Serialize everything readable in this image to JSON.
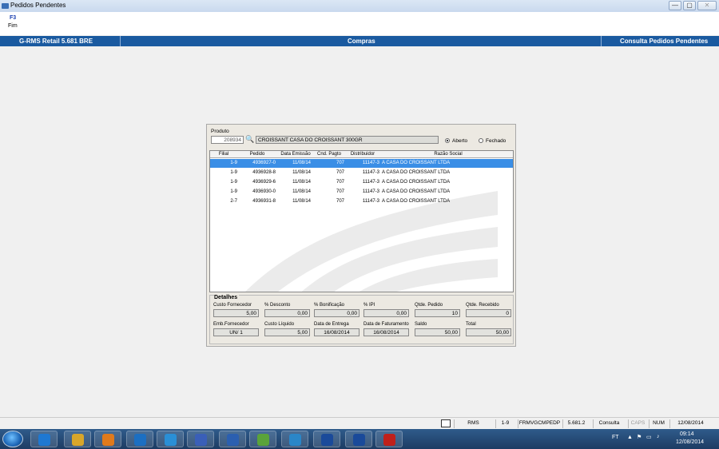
{
  "window": {
    "title": "Pedidos Pendentes",
    "minimize": "—",
    "maximize": "▢",
    "close": "✕"
  },
  "menu": {
    "key": "F3",
    "label": "Fim"
  },
  "header": {
    "app": "G-RMS Retail 5.681 BRE",
    "module": "Compras",
    "screen": "Consulta Pedidos Pendentes"
  },
  "product": {
    "label": "Produto",
    "code": "208934",
    "description": "CROISSANT CASA DO CROISSANT 300GR"
  },
  "status_filter": {
    "open_label": "Aberto",
    "closed_label": "Fechado",
    "selected": "Aberto"
  },
  "table": {
    "columns": [
      "Filial",
      "Pedido",
      "Data Emissão",
      "Cnd. Pagto",
      "Distribuidor",
      "Razão Social"
    ],
    "rows": [
      [
        "1-9",
        "4936927-0",
        "11/08/14",
        "707",
        "11147-3",
        "A CASA DO CROISSANT LTDA"
      ],
      [
        "1-9",
        "4936928-8",
        "11/08/14",
        "707",
        "11147-3",
        "A CASA DO CROISSANT LTDA"
      ],
      [
        "1-9",
        "4936929-6",
        "11/08/14",
        "707",
        "11147-3",
        "A CASA DO CROISSANT LTDA"
      ],
      [
        "1-9",
        "4936930-0",
        "11/08/14",
        "707",
        "11147-3",
        "A CASA DO CROISSANT LTDA"
      ],
      [
        "2-7",
        "4936931-8",
        "11/08/14",
        "707",
        "11147-3",
        "A CASA DO CROISSANT LTDA"
      ]
    ],
    "selected_row": 0
  },
  "details": {
    "title": "Detalhes",
    "fields": [
      {
        "label": "Custo Fornecedor",
        "value": "5,00"
      },
      {
        "label": "% Desconto",
        "value": "0,00"
      },
      {
        "label": "% Bonificação",
        "value": "0,00"
      },
      {
        "label": "% IPI",
        "value": "0,00"
      },
      {
        "label": "Qtde. Pedido",
        "value": "10"
      },
      {
        "label": "Qtde. Recebido",
        "value": "0"
      },
      {
        "label": "Emb.Fornecedor",
        "value": "UN/ 1"
      },
      {
        "label": "Custo Líquido",
        "value": "5,00"
      },
      {
        "label": "Data de Entrega",
        "value": "16/08/2014"
      },
      {
        "label": "Data de Faturamento",
        "value": "16/08/2014"
      },
      {
        "label": "Saldo",
        "value": "50,00"
      },
      {
        "label": "Total",
        "value": "50,00"
      }
    ]
  },
  "statusbar": {
    "cells": [
      "RMS",
      "1-9",
      "FRMVGCMPEDP",
      "5.681.2",
      "Consulta",
      "CAPS",
      "NUM",
      "12/08/2014"
    ]
  },
  "taskbar": {
    "apps": [
      "IE",
      "Explorer",
      "Media",
      "Outlook",
      "Lync",
      "Link",
      "Word",
      "Add",
      "Skype",
      "RMS",
      "RMS",
      "PDF"
    ],
    "tray": {
      "lang": "FT",
      "time": "09:14",
      "date": "12/08/2014"
    }
  },
  "colors": {
    "header_blue": "#1a5aa0",
    "selection": "#3a8ee6"
  }
}
